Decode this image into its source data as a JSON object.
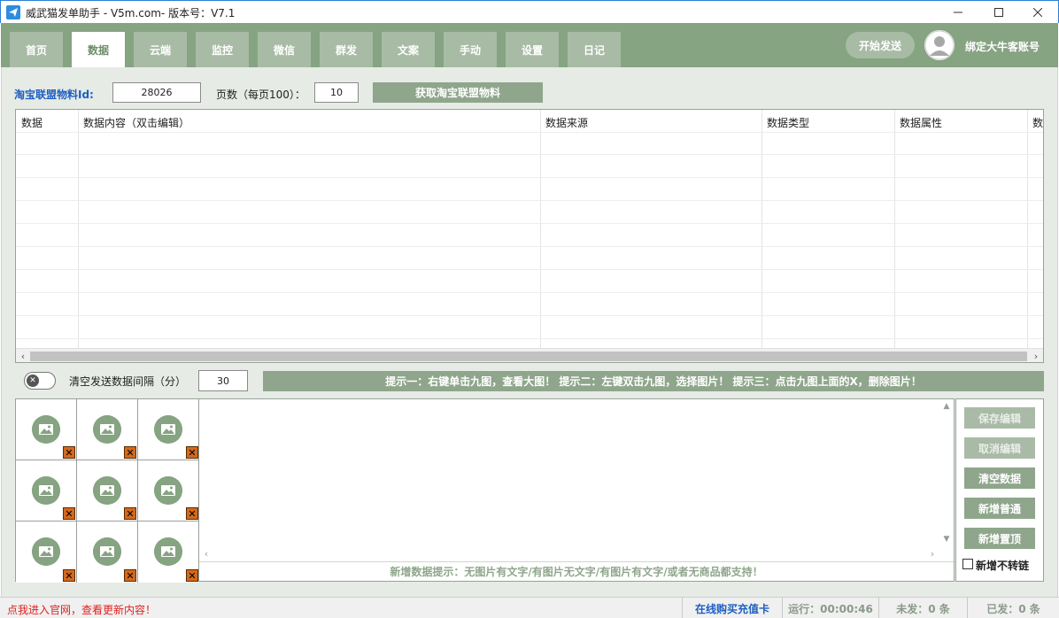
{
  "window": {
    "title": "威武猫发单助手 - V5m.com- 版本号：V7.1",
    "controls": [
      "minimize",
      "maximize",
      "close"
    ]
  },
  "tabs": [
    {
      "label": "首页",
      "active": false
    },
    {
      "label": "数据",
      "active": true
    },
    {
      "label": "云端",
      "active": false
    },
    {
      "label": "监控",
      "active": false
    },
    {
      "label": "微信",
      "active": false
    },
    {
      "label": "群发",
      "active": false
    },
    {
      "label": "文案",
      "active": false
    },
    {
      "label": "手动",
      "active": false
    },
    {
      "label": "设置",
      "active": false
    },
    {
      "label": "日记",
      "active": false
    }
  ],
  "header": {
    "start_label": "开始发送",
    "account_label": "绑定大牛客账号"
  },
  "fetch": {
    "id_label": "淘宝联盟物料Id:",
    "id_value": "28026",
    "pages_label": "页数（每页100）：",
    "pages_value": "10",
    "fetch_button": "获取淘宝联盟物料"
  },
  "grid": {
    "columns": [
      "数据",
      "数据内容（双击编辑）",
      "数据来源",
      "数据类型",
      "数据属性",
      "数"
    ],
    "rows": []
  },
  "interval": {
    "label": "清空发送数据间隔（分）",
    "value": "30",
    "toggle_on": false
  },
  "tips": "提示一：右键单击九图，查看大图！ 提示二：左键双击九图，选择图片！ 提示三：点击九图上面的X，删除图片！",
  "image_slots": 9,
  "editor": {
    "hint": "新增数据提示：无图片有文字/有图片无文字/有图片有文字/或者无商品都支持！"
  },
  "side_buttons": {
    "save": "保存编辑",
    "cancel": "取消编辑",
    "clear": "清空数据",
    "add_normal": "新增普通",
    "add_top": "新增置顶",
    "no_convert_label": "新增不转链",
    "no_convert_checked": false
  },
  "statusbar": {
    "link": "点我进入官网，查看更新内容！",
    "recharge": "在线购买充值卡",
    "runtime": "运行：00:00:46",
    "unsent": "未发：0 条",
    "sent": "已发：0 条"
  },
  "colors": {
    "accent_green": "#86a382",
    "button_green": "#8fa68c",
    "link_blue": "#1e5fc2",
    "alert_red": "#e02020"
  }
}
